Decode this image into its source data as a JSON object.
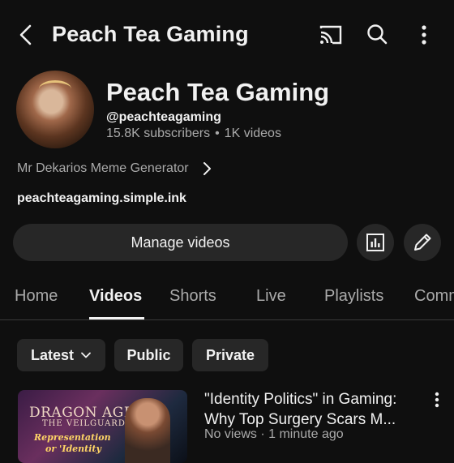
{
  "topbar": {
    "title": "Peach Tea Gaming"
  },
  "channel": {
    "name": "Peach Tea Gaming",
    "handle": "@peachteagaming",
    "subscribers": "15.8K subscribers",
    "separator": "•",
    "videos": "1K videos",
    "description": "Mr Dekarios Meme Generator",
    "link": "peachteagaming.simple.ink"
  },
  "actions": {
    "manage_label": "Manage videos"
  },
  "tabs": [
    {
      "label": "Home"
    },
    {
      "label": "Videos",
      "active": true
    },
    {
      "label": "Shorts"
    },
    {
      "label": "Live"
    },
    {
      "label": "Playlists"
    },
    {
      "label": "Comm"
    }
  ],
  "filters": {
    "latest": "Latest",
    "public": "Public",
    "private": "Private"
  },
  "video": {
    "title": "\"Identity Politics\" in Gaming: Why Top Surgery Scars M...",
    "meta": "No views · 1 minute ago",
    "thumbnail": {
      "logo": "DRAGON AGE",
      "sub": "THE VEILGUARD",
      "caption1": "Representation",
      "caption2": "or 'Identity"
    }
  },
  "colors": {
    "background": "#0f0f0f",
    "surface": "#272727",
    "text": "#f1f1f1",
    "muted": "#aaaaaa"
  },
  "icons": [
    "back-arrow-icon",
    "cast-icon",
    "search-icon",
    "more-vertical-icon",
    "chevron-right-icon",
    "analytics-icon",
    "edit-pencil-icon",
    "chevron-down-icon"
  ]
}
